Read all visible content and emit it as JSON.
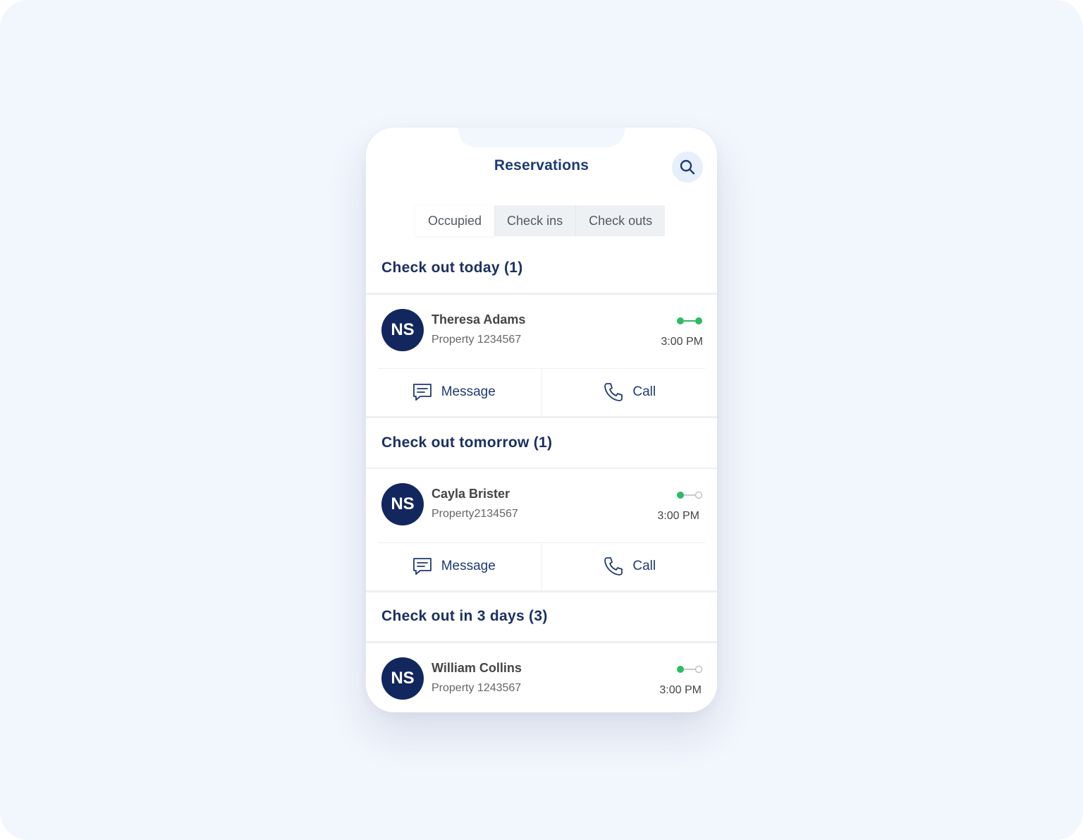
{
  "header": {
    "title": "Reservations",
    "search_icon": "search-icon"
  },
  "tabs": [
    {
      "label": "Occupied",
      "active": true
    },
    {
      "label": "Check ins",
      "active": false
    },
    {
      "label": "Check outs",
      "active": false
    }
  ],
  "sections": [
    {
      "title": "Check out today (1)",
      "reservations": [
        {
          "initials": "NS",
          "name": "Theresa Adams",
          "property": "Property 1234567",
          "time": "3:00 PM",
          "status": "complete",
          "actions": {
            "message": "Message",
            "call": "Call"
          }
        }
      ]
    },
    {
      "title": "Check out tomorrow (1)",
      "reservations": [
        {
          "initials": "NS",
          "name": "Cayla Brister",
          "property": "Property2134567",
          "time": "3:00 PM",
          "status": "in-progress",
          "actions": {
            "message": "Message",
            "call": "Call"
          }
        }
      ]
    },
    {
      "title": "Check out in 3 days (3)",
      "reservations": [
        {
          "initials": "NS",
          "name": "William Collins",
          "property": "Property 1243567",
          "time": "3:00 PM",
          "status": "in-progress"
        }
      ]
    }
  ],
  "colors": {
    "primary": "#1e3a74",
    "avatar": "#12275e",
    "status_green": "#2dbb63",
    "background": "#f2f6fd"
  }
}
